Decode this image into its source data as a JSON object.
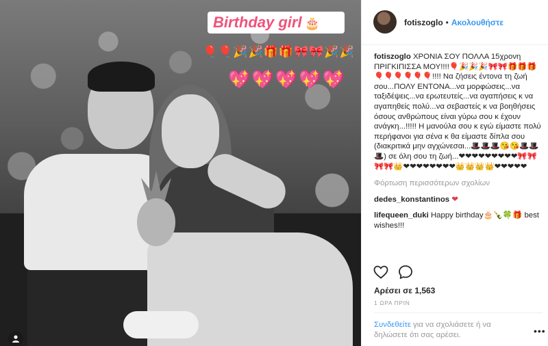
{
  "photo": {
    "sticker_text": "Birthday girl",
    "sticker_icon": "cake-icon",
    "emoji_row1": "🎈🎈🎉🎉🎁🎁🎀🎀🎉🎉",
    "emoji_row2": "💖💖💖💖💖",
    "user_tag_icon": "user-icon"
  },
  "header": {
    "username": "fotiszoglo",
    "separator": "•",
    "follow_label": "Ακολουθήστε"
  },
  "caption": {
    "author": "fotiszoglo",
    "text": "ΧΡΟΝΙΑ ΣΟΥ ΠΟΛΛΑ 15χρονη ΠΡΙΓΚΙΠΙΣΣΑ ΜΟΥ!!!!🎈🎉🎉🎉🎀🎀🎁🎁🎁🎈🎈🎈🎈🎈🎈!!!! Να ζήσεις έντονα τη ζωή σου...ΠΟΛΥ ΕΝΤΟΝΑ...να μορφώσεις...να ταξιδέψεις...να ερωτευτείς...να αγαπήσεις κ να αγαπηθείς πολύ...να σεβαστείς κ να βοηθήσεις όσους ανθρώπους είναι γύρω σου κ έχουν ανάγκη...!!!!! Η μανούλα σου κ εγώ είμαστε πολύ περήφανοι για σένα κ θα είμαστε δίπλα σου (διακριτικά μην αγχώνεσαι...🎩🎩🎩😘😘🎩🎩🎩) σε όλη σου τη ζωή...❤❤❤❤❤❤❤❤❤🎀🎀🎀🎀👑❤❤❤❤❤❤❤❤👑👑👑👑❤❤❤❤❤"
  },
  "load_more_label": "Φόρτωση περισσότερων σχολίων",
  "comments": [
    {
      "author": "dedes_konstantinos",
      "text": "❤"
    },
    {
      "author": "lifequeen_duki",
      "text": "Happy birthday🎂🍾🍀🎁 best wishes!!!"
    }
  ],
  "actions": {
    "like_icon": "heart-icon",
    "comment_icon": "comment-icon"
  },
  "likes_label": "Αρέσει σε 1,563",
  "time_label": "1 ΩΡΑ ΠΡΙΝ",
  "login_prompt": {
    "link": "Συνδεθείτε",
    "text": " για να σχολιάσετε ή να δηλώσετε ότι σας αρέσει."
  },
  "more_label": "•••",
  "colors": {
    "link_blue": "#3897f0",
    "text_dark": "#262626",
    "text_muted": "#999999",
    "sticker_pink": "#f0527a"
  }
}
